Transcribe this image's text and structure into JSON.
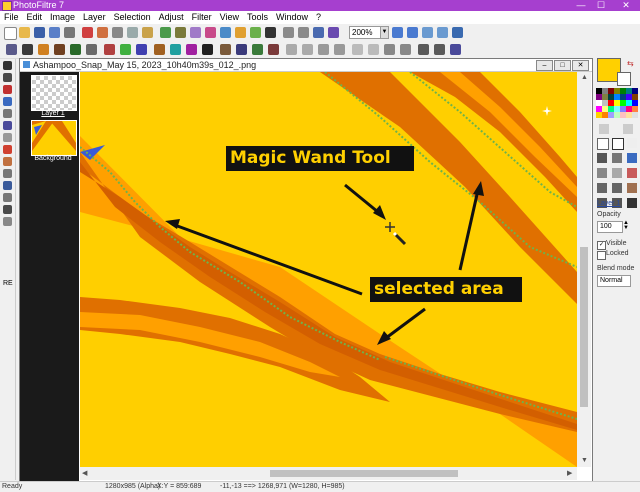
{
  "window": {
    "title": "PhotoFiltre 7",
    "minimize": "—",
    "maximize": "☐",
    "close": "✕"
  },
  "menu": [
    "File",
    "Edit",
    "Image",
    "Layer",
    "Selection",
    "Adjust",
    "Filter",
    "View",
    "Tools",
    "Window",
    "?"
  ],
  "toolbar": {
    "zoom": "200%",
    "zoom_arrow": "▼"
  },
  "document": {
    "title": "Ashampoo_Snap_May 15, 2023_10h40m39s_012_.png",
    "btn_min": "–",
    "btn_max": "□",
    "btn_close": "✕"
  },
  "layers": {
    "layer1": "Layer 1",
    "background": "Background"
  },
  "left_tools_label": "RE",
  "annotations": {
    "tool_label": "Magic Wand Tool",
    "selected_label": "selected area"
  },
  "right_panel": {
    "layer_name": "Layer 1",
    "opacity_label": "Opacity",
    "opacity_value": "100",
    "visible_label": "Visible",
    "visible_check": "✓",
    "locked_label": "Locked",
    "blend_label": "Blend mode",
    "blend_value": "Normal"
  },
  "status": {
    "ready": "Ready",
    "size": "1280x985 (Alpha)",
    "coords": "X:Y = 859:689",
    "selection": "-11,-13 ==> 1268,971 (W=1280, H=985)"
  },
  "colors": {
    "title_bar": "#a63fcf",
    "canvas_yellow": "#ffcf00",
    "stripe_orange": "#e07000",
    "fg_color": "#ffd000"
  }
}
